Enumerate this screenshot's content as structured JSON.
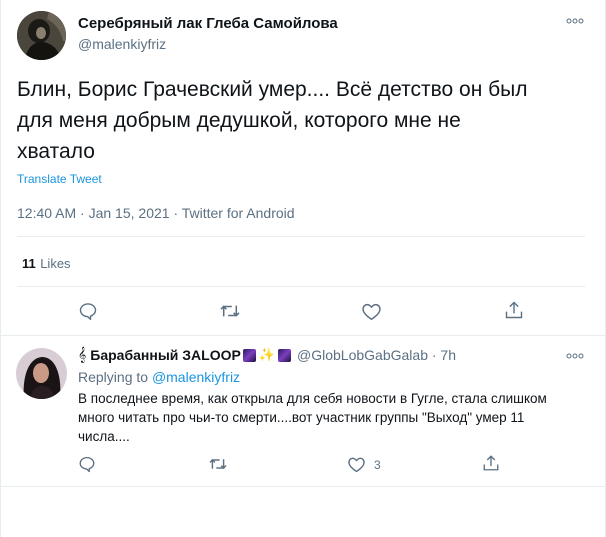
{
  "main_tweet": {
    "display_name": "Серебряный лак Глеба Самойлова",
    "handle": "@malenkiyfriz",
    "text_line1": "Блин, Борис Грачевский умер.... Всё детство он был",
    "text_line2": "для меня добрым дедушкой, которого мне не",
    "text_line3": "хватало",
    "translate_label": "Translate Tweet",
    "timestamp": "12:40 AM · Jan 15, 2021 · Twitter for Android",
    "likes_count": "11",
    "likes_label": "Likes"
  },
  "reply_tweet": {
    "name_prefix_icon": "music-score-emoji",
    "display_name": "Барабанный ЗALOOP",
    "name_emojis": [
      "milky-way-emoji",
      "sparkles-emoji",
      "milky-way-emoji"
    ],
    "handle_time": "@GlobLobGabGalab · 7h",
    "replying_prefix": "Replying to",
    "replying_handle": "@malenkiyfriz",
    "text_line1": "В последнее время, как открыла для себя новости в Гугле, стала слишком",
    "text_line2": "много читать про чьи-то смерти....вот участник группы \"Выход\" умер 11",
    "text_line3": "числа....",
    "like_count": "3"
  },
  "colors": {
    "link": "#1b95e0",
    "muted": "#5b7083",
    "text": "#0f1419",
    "divider": "#e6ecf0"
  }
}
